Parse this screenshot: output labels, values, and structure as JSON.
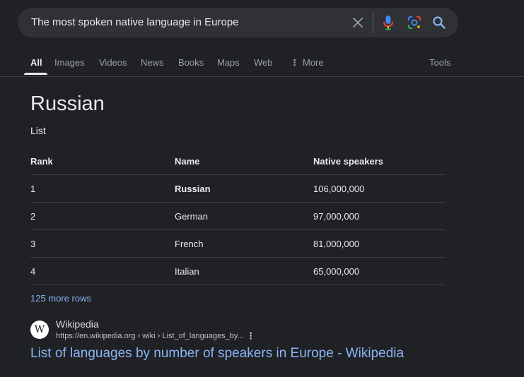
{
  "search": {
    "query": "The most spoken native language in Europe"
  },
  "tabs": [
    {
      "label": "All"
    },
    {
      "label": "Images"
    },
    {
      "label": "Videos"
    },
    {
      "label": "News"
    },
    {
      "label": "Books"
    },
    {
      "label": "Maps"
    },
    {
      "label": "Web"
    },
    {
      "label": "More"
    }
  ],
  "tools_label": "Tools",
  "answer": {
    "title": "Russian",
    "subtitle": "List",
    "table": {
      "headers": [
        "Rank",
        "Name",
        "Native speakers"
      ],
      "rows": [
        [
          "1",
          "Russian",
          "106,000,000"
        ],
        [
          "2",
          "German",
          "97,000,000"
        ],
        [
          "3",
          "French",
          "81,000,000"
        ],
        [
          "4",
          "Italian",
          "65,000,000"
        ]
      ]
    },
    "more_rows": "125 more rows"
  },
  "result": {
    "favicon_letter": "W",
    "site_name": "Wikipedia",
    "url": "https://en.wikipedia.org › wiki › List_of_languages_by...",
    "title": "List of languages by number of speakers in Europe - Wikipedia"
  },
  "colors": {
    "background": "#202124",
    "link": "#8ab4f8",
    "text": "#e8eaed"
  }
}
